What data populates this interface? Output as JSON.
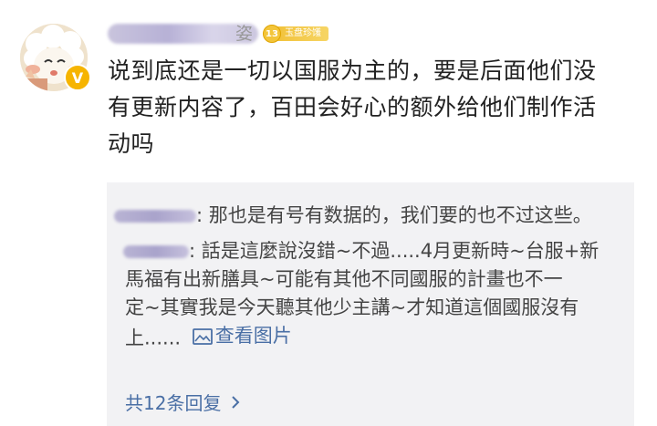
{
  "comment": {
    "author_visible_tail": "姿",
    "level": {
      "number": "13",
      "name": "玉盘珍馐"
    },
    "verified_badge": "V",
    "text_lines": [
      "说到底还是一切以国服为主的，要是后面他们没",
      "有更新内容了，百田会好心的额外给他们制作活",
      "动吗"
    ]
  },
  "replies": [
    {
      "text_lines": [
        "那也是有号有数据的，我们要的也不过这些。"
      ]
    },
    {
      "text_lines": [
        "話是這麼說沒錯~不過.....4月更新時~台服+新",
        "馬福有出新膳具~可能有其他不同國服的計畫也不一",
        "定~其實我是今天聽其他少主講~才知道這個國服沒有",
        "上......"
      ],
      "view_image_label": "查看图片"
    }
  ],
  "more_replies_label": "共12条回复",
  "colors": {
    "link": "#4a6fa5",
    "reply_bg": "#f2f2f4",
    "badge_gold": "#f3c53a"
  }
}
